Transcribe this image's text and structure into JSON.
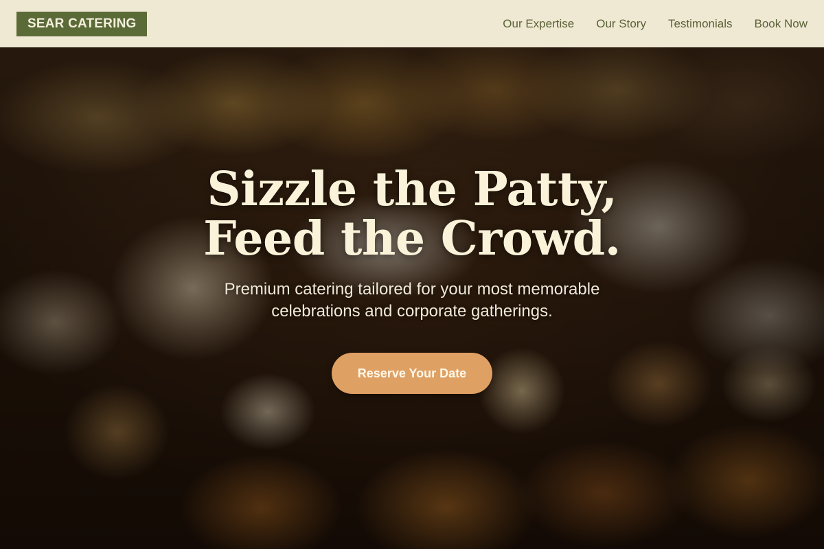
{
  "brand": {
    "name": "SEAR CATERING"
  },
  "nav": {
    "items": [
      {
        "label": "Our Expertise"
      },
      {
        "label": "Our Story"
      },
      {
        "label": "Testimonials"
      },
      {
        "label": "Book Now"
      }
    ]
  },
  "hero": {
    "title_line1": "Sizzle the Patty,",
    "title_line2": "Feed the Crowd.",
    "subtitle_line1": "Premium catering tailored for your most memorable",
    "subtitle_line2": "celebrations and corporate gatherings.",
    "cta_label": "Reserve Your Date",
    "background": "food-platter-photo"
  },
  "colors": {
    "brand_bg": "#5b6b37",
    "nav_bg": "#efe8d3",
    "nav_text": "#5a6236",
    "title_text": "#fbf3d9",
    "cta_bg": "#dfa063"
  }
}
